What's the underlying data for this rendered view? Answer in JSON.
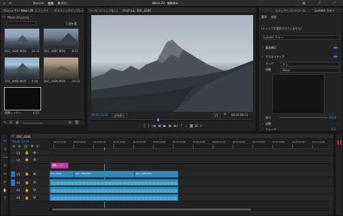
{
  "topbar": {
    "tabs": [
      "読み込み",
      "編集",
      "書き出し"
    ],
    "active_tab": "編集",
    "title": "Nikon Z9 - 編集済み"
  },
  "project_panel": {
    "tabs": [
      "プロジェクト: Nikon Z9",
      "エフェクト",
      "グラフィックテンプレート"
    ],
    "path": "Nikon Z9.prproj",
    "items_label": "1 個を選",
    "clips": [
      {
        "name": "DSC_4026.MOV",
        "duration": "10:22"
      },
      {
        "name": "DSC_4087.MOV",
        "duration": "8:13"
      },
      {
        "name": "DSC_4069.MOV",
        "duration": "9:18"
      },
      {
        "name": "DSC_4099.MOV",
        "duration": "10:22"
      },
      {
        "name": "調整レイヤー",
        "duration": "4:25"
      }
    ]
  },
  "program_monitor": {
    "tabs": [
      "ソース: (クリップなし)",
      "プログラム: DSC_4246"
    ],
    "timecode_current": "00:01:13:01",
    "fit": "全体表示",
    "quality": "1/2",
    "timecode_duration": "00:02:08:21"
  },
  "right_panel": {
    "tabs": [
      "エフェクトコントロール",
      "Lumetri カラー"
    ],
    "subtabs": [
      "基本",
      "描画"
    ],
    "source_label": "(ティップが選択されていません)",
    "preset_label": "Lumetri カラー",
    "sections": [
      {
        "name": "基本補正",
        "enabled": true
      },
      {
        "name": "クリエイティブ",
        "enabled": true
      }
    ],
    "look_label": "ルック",
    "look_value": "なし",
    "intensity_label": "強さ",
    "intensity_value": "100.0",
    "adjust_label": "調整",
    "adjust_value": "None",
    "faded_film_label": "フェード",
    "sharpen_label": "シャープ",
    "vibrance_label": "自然な彩度",
    "saturation_label": "彩度",
    "bottom_section": "調整",
    "bottom_values": [
      "0.0",
      "0.0"
    ]
  },
  "timeline": {
    "sequence_name": "DSC_4246",
    "timecode": "00:01:13:01",
    "ruler_times": [
      "00:00:15:00",
      "00:00:30:00",
      "00:00:45:00",
      "00:01:00:00",
      "00:01:15:00",
      "00:01:30:00",
      "00:01:45:00",
      "00:02:00:00",
      "00:02:15:00",
      "00:02:30:00",
      "00:02:45:00",
      "00:03:00:00",
      "00:03:15:00",
      "00:03:30:00"
    ],
    "video_tracks": [
      "V3",
      "V2",
      "V1"
    ],
    "audio_tracks": [
      "A1",
      "A2",
      "A3"
    ],
    "clips_v1": [
      "DSC_4024",
      "DSC_4048.MOV",
      "DSC_4262.MOV"
    ],
    "clip_v2": "調整レイヤー",
    "audio_clip_label": "fx"
  },
  "colors": {
    "accent": "#2e6fd6",
    "clip": "#2c8bc2",
    "adjustment_clip": "#c43aa8",
    "playhead": "#4d8fe0"
  }
}
